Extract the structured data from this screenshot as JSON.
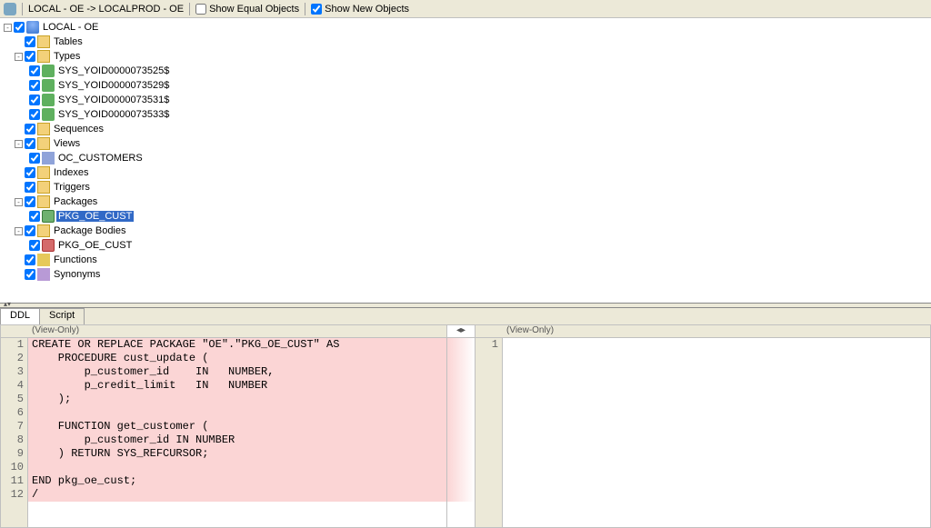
{
  "toolbar": {
    "path": "LOCAL - OE -> LOCALPROD - OE",
    "show_equal_label": "Show Equal Objects",
    "show_equal_checked": false,
    "show_new_label": "Show New Objects",
    "show_new_checked": true
  },
  "tree": {
    "root": "LOCAL - OE",
    "tables": "Tables",
    "types": "Types",
    "type_items": [
      "SYS_YOID0000073525$",
      "SYS_YOID0000073529$",
      "SYS_YOID0000073531$",
      "SYS_YOID0000073533$"
    ],
    "sequences": "Sequences",
    "views": "Views",
    "view_items": [
      "OC_CUSTOMERS"
    ],
    "indexes": "Indexes",
    "triggers": "Triggers",
    "packages": "Packages",
    "package_items": [
      "PKG_OE_CUST"
    ],
    "package_bodies": "Package Bodies",
    "package_body_items": [
      "PKG_OE_CUST"
    ],
    "functions": "Functions",
    "synonyms": "Synonyms"
  },
  "tabs": {
    "ddl": "DDL",
    "script": "Script"
  },
  "viewonly": "(View-Only)",
  "code_left": [
    "CREATE OR REPLACE PACKAGE \"OE\".\"PKG_OE_CUST\" AS",
    "    PROCEDURE cust_update (",
    "        p_customer_id    IN   NUMBER,",
    "        p_credit_limit   IN   NUMBER",
    "    );",
    "",
    "    FUNCTION get_customer (",
    "        p_customer_id IN NUMBER",
    "    ) RETURN SYS_REFCURSOR;",
    "",
    "END pkg_oe_cust;",
    "/"
  ],
  "code_right": [
    ""
  ],
  "colors": {
    "diff_bg": "#fbd5d5",
    "select_bg": "#3169c6"
  }
}
